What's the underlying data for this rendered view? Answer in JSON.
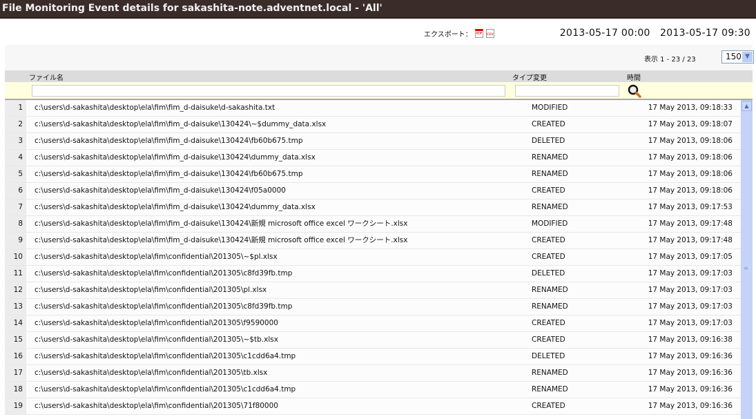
{
  "title": "File Monitoring Event details for sakashita-note.adventnet.local - 'All'",
  "export": {
    "label": "エクスポート：",
    "pdf": "PDF",
    "csv": "csv"
  },
  "range": {
    "start": "2013-05-17 00:00",
    "end": "2013-05-17 09:30"
  },
  "pagination": {
    "text": "表示 1 - 23 / 23",
    "page_size": "150"
  },
  "columns": {
    "file": "ファイル名",
    "type": "タイプ変更",
    "time": "時間"
  },
  "filters": {
    "file": "",
    "type": ""
  },
  "rows": [
    {
      "n": "1",
      "path": "c:\\users\\d-sakashita\\desktop\\ela\\fim\\fim_d-daisuke\\d-sakashita.txt",
      "type": "MODIFIED",
      "time": "17 May 2013, 09:18:33"
    },
    {
      "n": "2",
      "path": "c:\\users\\d-sakashita\\desktop\\ela\\fim\\fim_d-daisuke\\130424\\~$dummy_data.xlsx",
      "type": "CREATED",
      "time": "17 May 2013, 09:18:07"
    },
    {
      "n": "3",
      "path": "c:\\users\\d-sakashita\\desktop\\ela\\fim\\fim_d-daisuke\\130424\\fb60b675.tmp",
      "type": "DELETED",
      "time": "17 May 2013, 09:18:06"
    },
    {
      "n": "4",
      "path": "c:\\users\\d-sakashita\\desktop\\ela\\fim\\fim_d-daisuke\\130424\\dummy_data.xlsx",
      "type": "RENAMED",
      "time": "17 May 2013, 09:18:06"
    },
    {
      "n": "5",
      "path": "c:\\users\\d-sakashita\\desktop\\ela\\fim\\fim_d-daisuke\\130424\\fb60b675.tmp",
      "type": "RENAMED",
      "time": "17 May 2013, 09:18:06"
    },
    {
      "n": "6",
      "path": "c:\\users\\d-sakashita\\desktop\\ela\\fim\\fim_d-daisuke\\130424\\f05a0000",
      "type": "CREATED",
      "time": "17 May 2013, 09:18:06"
    },
    {
      "n": "7",
      "path": "c:\\users\\d-sakashita\\desktop\\ela\\fim\\fim_d-daisuke\\130424\\dummy_data.xlsx",
      "type": "RENAMED",
      "time": "17 May 2013, 09:17:53"
    },
    {
      "n": "8",
      "path": "c:\\users\\d-sakashita\\desktop\\ela\\fim\\fim_d-daisuke\\130424\\新規 microsoft office excel ワークシート.xlsx",
      "type": "MODIFIED",
      "time": "17 May 2013, 09:17:48"
    },
    {
      "n": "9",
      "path": "c:\\users\\d-sakashita\\desktop\\ela\\fim\\fim_d-daisuke\\130424\\新規 microsoft office excel ワークシート.xlsx",
      "type": "CREATED",
      "time": "17 May 2013, 09:17:48"
    },
    {
      "n": "10",
      "path": "c:\\users\\d-sakashita\\desktop\\ela\\fim\\confidential\\201305\\~$pl.xlsx",
      "type": "CREATED",
      "time": "17 May 2013, 09:17:05"
    },
    {
      "n": "11",
      "path": "c:\\users\\d-sakashita\\desktop\\ela\\fim\\confidential\\201305\\c8fd39fb.tmp",
      "type": "DELETED",
      "time": "17 May 2013, 09:17:03"
    },
    {
      "n": "12",
      "path": "c:\\users\\d-sakashita\\desktop\\ela\\fim\\confidential\\201305\\pl.xlsx",
      "type": "RENAMED",
      "time": "17 May 2013, 09:17:03"
    },
    {
      "n": "13",
      "path": "c:\\users\\d-sakashita\\desktop\\ela\\fim\\confidential\\201305\\c8fd39fb.tmp",
      "type": "RENAMED",
      "time": "17 May 2013, 09:17:03"
    },
    {
      "n": "14",
      "path": "c:\\users\\d-sakashita\\desktop\\ela\\fim\\confidential\\201305\\f9590000",
      "type": "CREATED",
      "time": "17 May 2013, 09:17:03"
    },
    {
      "n": "15",
      "path": "c:\\users\\d-sakashita\\desktop\\ela\\fim\\confidential\\201305\\~$tb.xlsx",
      "type": "CREATED",
      "time": "17 May 2013, 09:16:38"
    },
    {
      "n": "16",
      "path": "c:\\users\\d-sakashita\\desktop\\ela\\fim\\confidential\\201305\\c1cdd6a4.tmp",
      "type": "DELETED",
      "time": "17 May 2013, 09:16:36"
    },
    {
      "n": "17",
      "path": "c:\\users\\d-sakashita\\desktop\\ela\\fim\\confidential\\201305\\tb.xlsx",
      "type": "RENAMED",
      "time": "17 May 2013, 09:16:36"
    },
    {
      "n": "18",
      "path": "c:\\users\\d-sakashita\\desktop\\ela\\fim\\confidential\\201305\\c1cdd6a4.tmp",
      "type": "RENAMED",
      "time": "17 May 2013, 09:16:36"
    },
    {
      "n": "19",
      "path": "c:\\users\\d-sakashita\\desktop\\ela\\fim\\confidential\\201305\\71f80000",
      "type": "CREATED",
      "time": "17 May 2013, 09:16:36"
    }
  ]
}
